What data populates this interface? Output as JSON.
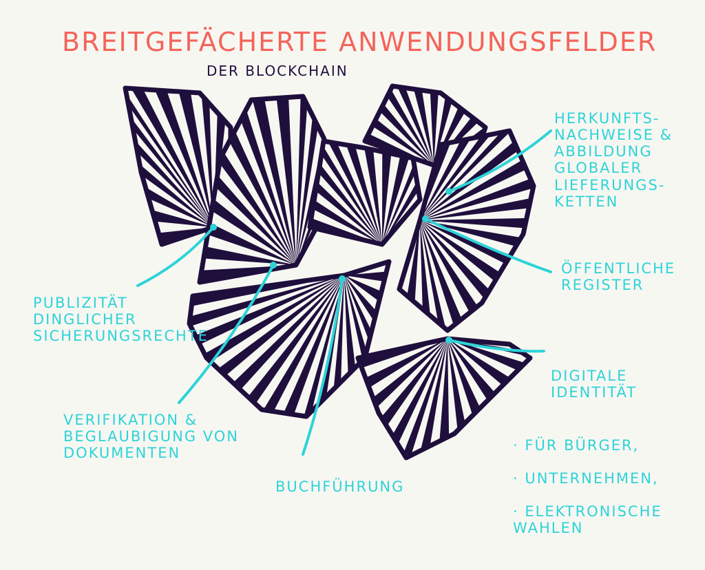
{
  "title": "BREITGEFÄCHERTE ANWENDUNGSFELDER",
  "subtitle": "DER BLOCKCHAIN",
  "colors": {
    "background": "#f7f7f2",
    "title": "#f4645a",
    "fans": "#1f0f3d",
    "labels": "#2ed3d8"
  },
  "labels": {
    "herkunft": "HERKUNFTS-\nNACHWEISE &\nABBILDUNG\nGLOBALER\nLIEFERUNGS-\nKETTEN",
    "register": "ÖFFENTLICHE\nREGISTER",
    "identitaet": {
      "heading": "DIGITALE\nIDENTITÄT",
      "items": [
        "FÜR BÜRGER,",
        "UNTERNEHMEN,",
        "ELEKTRONISCHE\nWAHLEN"
      ]
    },
    "buchfuehrung": "BUCHFÜHRUNG",
    "verifikation": "VERIFIKATION &\nBEGLAUBIGUNG VON\nDOKUMENTEN",
    "publizitaet": "PUBLIZITÄT\nDINGLICHER\nSICHERUNGSRECHTE"
  }
}
